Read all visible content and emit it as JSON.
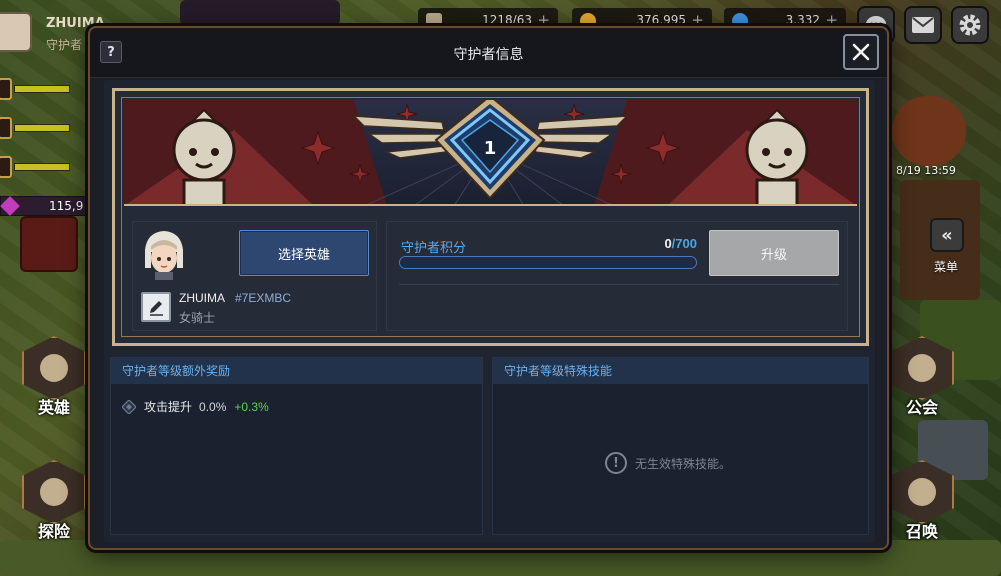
{
  "background": {
    "user": {
      "name": "ZHUIMA",
      "role": "守护者"
    },
    "gem_count": "115,9",
    "timer": "8/19 13:59",
    "menu_label": "菜单",
    "nav_left": [
      {
        "label": "英雄"
      },
      {
        "label": "探险"
      }
    ],
    "nav_right": [
      {
        "label": "公会"
      },
      {
        "label": "召唤"
      }
    ],
    "resources": [
      {
        "value": "1218/63"
      },
      {
        "value": "376,995"
      },
      {
        "value": "3,332"
      }
    ]
  },
  "modal": {
    "title": "守护者信息",
    "help_label": "?",
    "rank_level": "1",
    "choose_hero_label": "选择英雄",
    "hero": {
      "name": "ZHUIMA",
      "tag": "#7EXMBC",
      "class": "女骑士"
    },
    "points": {
      "label": "守护者积分",
      "current": "0",
      "separator": "/",
      "max": "700",
      "progress": 0
    },
    "upgrade_label": "升级",
    "bonus_panel": {
      "title": "守护者等级额外奖励",
      "rows": [
        {
          "label": "攻击提升",
          "current": "0.0%",
          "increase": "+0.3%"
        }
      ]
    },
    "skill_panel": {
      "title": "守护者等级特殊技能",
      "empty_text": "无生效特殊技能。"
    }
  },
  "colors": {
    "accent_blue": "#4aa6ea",
    "bonus_green": "#5bd54b",
    "banner_red": "#5b1f22",
    "frame_gold": "#c9b38a"
  }
}
